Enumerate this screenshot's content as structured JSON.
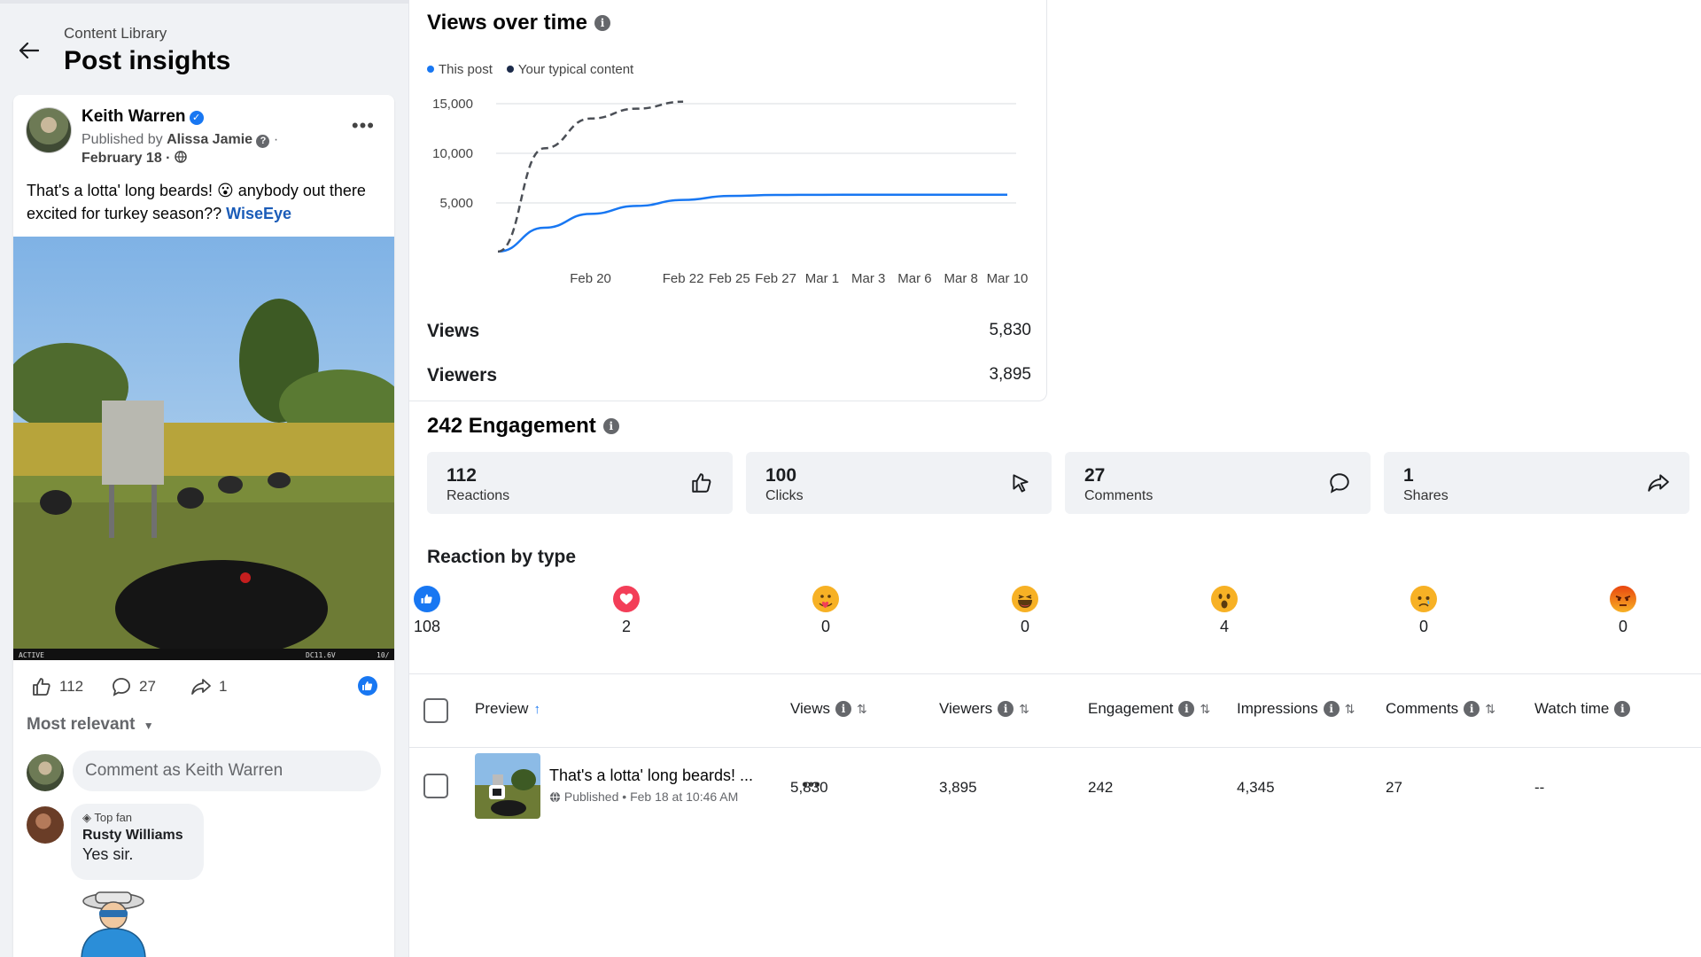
{
  "header": {
    "breadcrumb": "Content Library",
    "title": "Post insights"
  },
  "post": {
    "author": "Keith Warren",
    "published_prefix": "Published by",
    "publisher": "Alissa Jamie",
    "date": "February 18",
    "text_part1": "That's a lotta' long beards! 😮 anybody out there excited for turkey season??",
    "link": "WiseEye",
    "camera_left": "ACTIVE",
    "camera_right": "DC11.6V",
    "camera_right2": "10/",
    "reactions_count": "112",
    "comments_count": "27",
    "shares_count": "1"
  },
  "comments": {
    "sort_label": "Most relevant",
    "input_placeholder": "Comment as Keith Warren",
    "badge": "Top fan",
    "commenter": "Rusty Williams",
    "text": "Yes sir."
  },
  "views": {
    "title": "Views over time",
    "legend": [
      "This post",
      "Your typical content"
    ],
    "views_label": "Views",
    "views_value": "5,830",
    "viewers_label": "Viewers",
    "viewers_value": "3,895"
  },
  "chart_data": {
    "type": "line",
    "x": [
      "Feb 18",
      "Feb 19",
      "Feb 20",
      "Feb 21",
      "Feb 22",
      "Feb 25",
      "Feb 27",
      "Mar 1",
      "Mar 3",
      "Mar 6",
      "Mar 8",
      "Mar 10"
    ],
    "x_tick_labels": [
      "Feb 20",
      "Feb 22",
      "Feb 25",
      "Feb 27",
      "Mar 1",
      "Mar 3",
      "Mar 6",
      "Mar 8",
      "Mar 10"
    ],
    "y_ticks": [
      "15,000",
      "10,000",
      "5,000"
    ],
    "ylim": [
      0,
      15000
    ],
    "series": [
      {
        "name": "This post",
        "color": "#1877f2",
        "style": "solid",
        "values": [
          100,
          2500,
          3900,
          4700,
          5300,
          5700,
          5800,
          5820,
          5830,
          5830,
          5830,
          5830
        ]
      },
      {
        "name": "Your typical content",
        "color": "#4b4f56",
        "style": "dashed",
        "values": [
          100,
          10500,
          13500,
          14500,
          15200
        ]
      }
    ]
  },
  "engagement": {
    "title": "242 Engagement",
    "cards": [
      {
        "value": "112",
        "label": "Reactions",
        "icon": "thumbs-up-icon"
      },
      {
        "value": "100",
        "label": "Clicks",
        "icon": "cursor-click-icon"
      },
      {
        "value": "27",
        "label": "Comments",
        "icon": "comment-icon"
      },
      {
        "value": "1",
        "label": "Shares",
        "icon": "share-icon"
      }
    ]
  },
  "reactions": {
    "title": "Reaction by type",
    "items": [
      {
        "type": "like",
        "count": "108",
        "color": "#1877f2"
      },
      {
        "type": "love",
        "count": "2",
        "color": "#f33e58"
      },
      {
        "type": "care",
        "count": "0",
        "color": "#f7b125"
      },
      {
        "type": "haha",
        "count": "0",
        "color": "#f7b125"
      },
      {
        "type": "wow",
        "count": "4",
        "color": "#f7b125"
      },
      {
        "type": "sad",
        "count": "0",
        "color": "#f7b125"
      },
      {
        "type": "angry",
        "count": "0",
        "color": "#e9710f"
      }
    ]
  },
  "table": {
    "columns": [
      "Preview",
      "Views",
      "Viewers",
      "Engagement",
      "Impressions",
      "Comments",
      "Watch time"
    ],
    "row": {
      "title": "That's a lotta' long beards! ...",
      "status": "Published",
      "date": "Feb 18 at 10:46 AM",
      "views": "5,830",
      "viewers": "3,895",
      "engagement": "242",
      "impressions": "4,345",
      "comments": "27",
      "watch_time": "--"
    }
  }
}
